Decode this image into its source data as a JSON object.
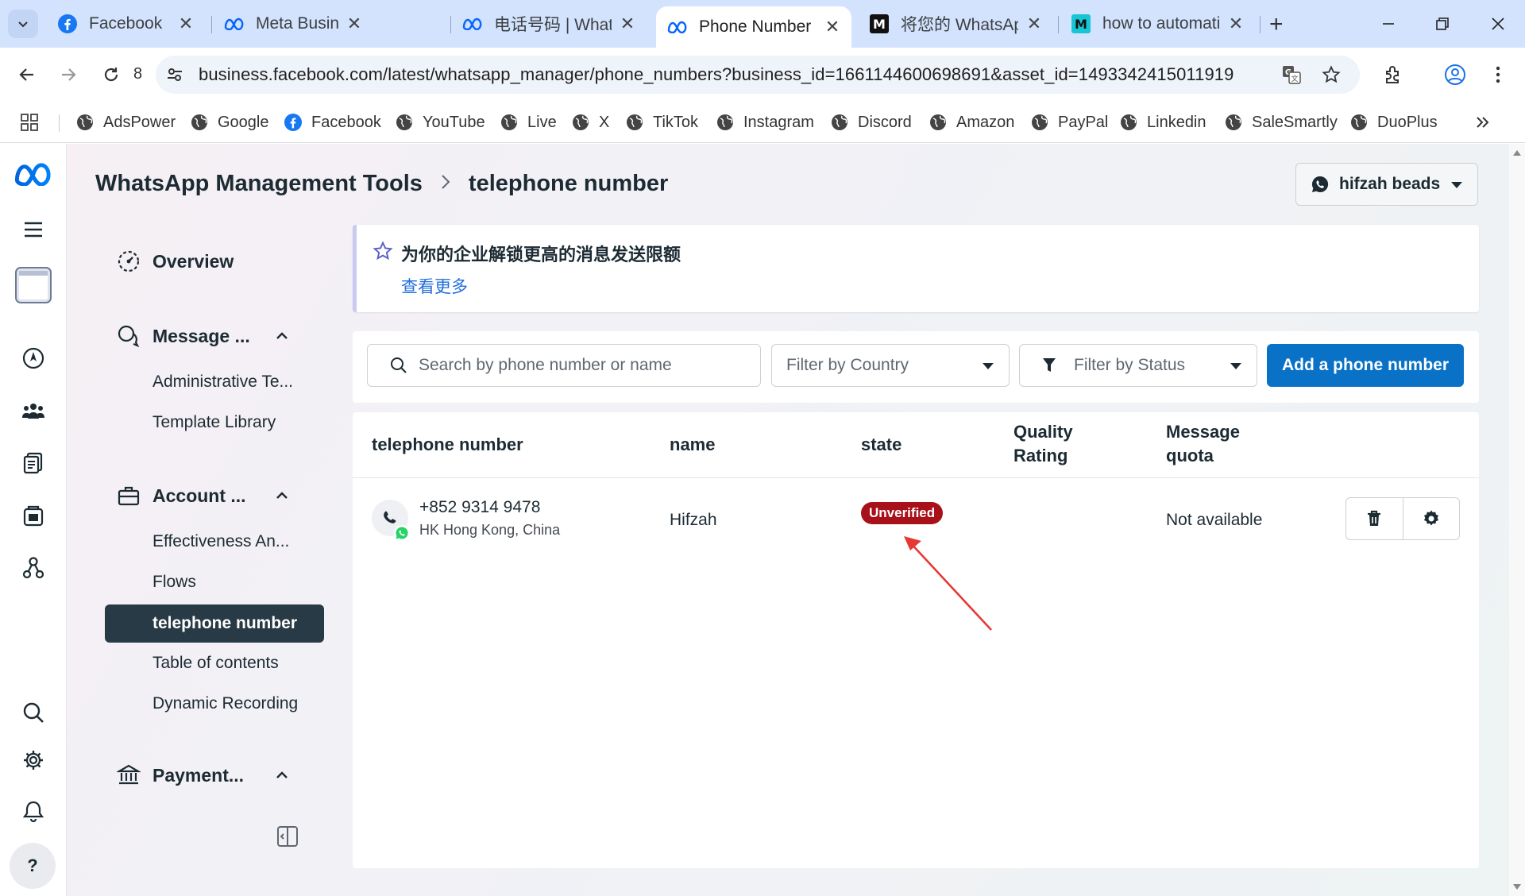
{
  "browser": {
    "tabs": [
      {
        "title": "Facebook",
        "favicon": "facebook-icon",
        "active": false
      },
      {
        "title": "Meta Business Su",
        "favicon": "meta-icon",
        "active": false
      },
      {
        "title": "电话号码 | Whats/",
        "favicon": "meta-icon",
        "active": false
      },
      {
        "title": "Phone Number |",
        "favicon": "meta-icon",
        "active": true
      },
      {
        "title": "将您的 WhatsApp",
        "favicon": "m-logo-icon",
        "active": false
      },
      {
        "title": "how to automatic",
        "favicon": "m-logo-cyan-icon",
        "active": false
      }
    ],
    "reload_badge": "8",
    "url": "business.facebook.com/latest/whatsapp_manager/phone_numbers?business_id=1661144600698691&asset_id=1493342415011919",
    "bookmarks": [
      "AdsPower",
      "Google",
      "Facebook",
      "YouTube",
      "Live",
      "X",
      "TikTok",
      "Instagram",
      "Discord",
      "Amazon",
      "PayPal",
      "Linkedin",
      "SaleSmartly",
      "DuoPlus"
    ]
  },
  "header": {
    "breadcrumb_root": "WhatsApp Management Tools",
    "breadcrumb_current": "telephone number",
    "account_name": "hifzah beads"
  },
  "sidebar": {
    "overview": "Overview",
    "sections": [
      {
        "label": "Message ...",
        "items": [
          "Administrative Te...",
          "Template Library"
        ]
      },
      {
        "label": "Account ...",
        "items": [
          "Effectiveness An...",
          "Flows",
          "telephone number",
          "Table of contents",
          "Dynamic Recording"
        ]
      },
      {
        "label": "Payment...",
        "items": []
      }
    ],
    "active_item": "telephone number"
  },
  "banner": {
    "title": "为你的企业解锁更高的消息发送限额",
    "link": "查看更多"
  },
  "filters": {
    "search_placeholder": "Search by phone number or name",
    "country_placeholder": "Filter by Country",
    "status_placeholder": "Filter by Status",
    "add_button": "Add a phone number"
  },
  "table": {
    "columns": [
      "telephone number",
      "name",
      "state",
      "Quality Rating",
      "Message quota"
    ],
    "rows": [
      {
        "phone": "+852 9314 9478",
        "region": "HK Hong Kong, China",
        "name": "Hifzah",
        "state": "Unverified",
        "quality_rating": "",
        "message_quota": "Not available"
      }
    ]
  },
  "colors": {
    "brand_blue": "#0a72c6",
    "badge_red": "#a8101a",
    "annotation_arrow": "#e53935",
    "active_nav_bg": "#283a45"
  }
}
